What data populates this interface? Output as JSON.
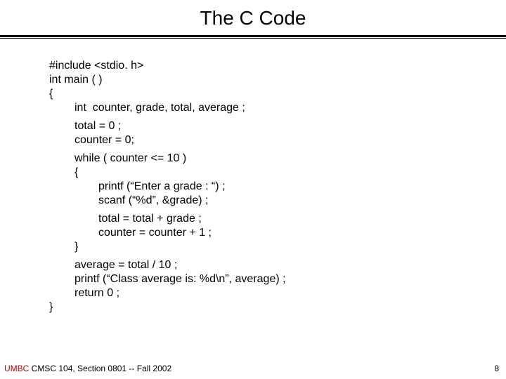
{
  "title": "The C Code",
  "code": {
    "l1": "#include <stdio. h>",
    "l2": "int main ( )",
    "l3": "{",
    "l4": "int  counter, grade, total, average ;",
    "l5": "total = 0 ;",
    "l6": "counter = 0;",
    "l7": "while ( counter <= 10 )",
    "l8": "{",
    "l9": "printf (“Enter a grade : “) ;",
    "l10": "scanf (“%d”, &grade) ;",
    "l11": "total = total + grade ;",
    "l12": "counter = counter + 1 ;",
    "l13": "}",
    "l14": "average = total / 10 ;",
    "l15": "printf (“Class average is: %d\\n”, average) ;",
    "l16": "return 0 ;",
    "l17": "}"
  },
  "footer": {
    "umbc": "UMBC",
    "course": " CMSC 104, Section 0801 -- Fall 2002",
    "page": "8"
  }
}
